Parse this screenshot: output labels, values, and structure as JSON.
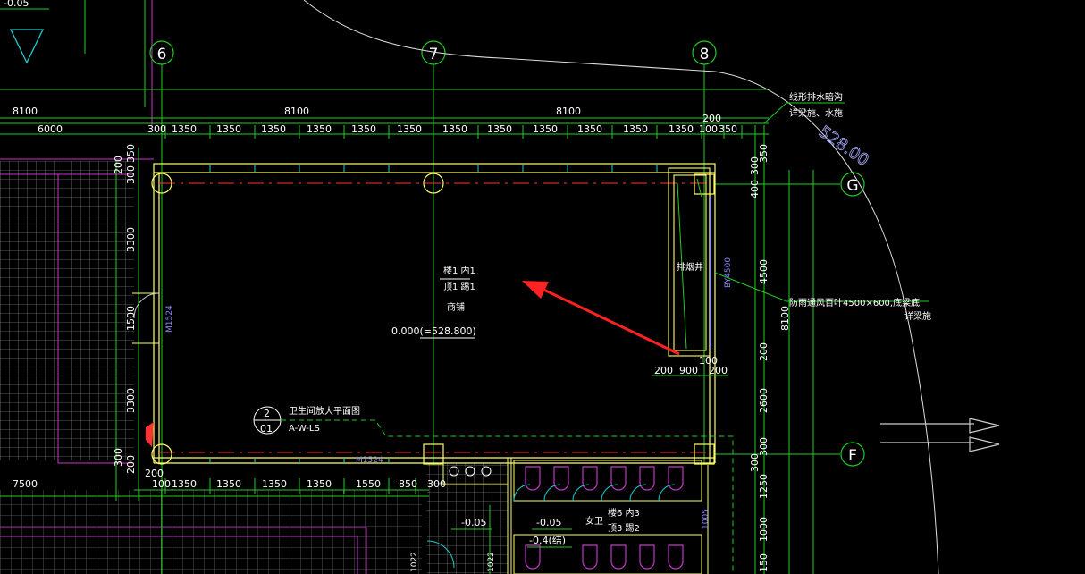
{
  "axes": {
    "col6": "6",
    "col7": "7",
    "col8": "8",
    "rowG": "G",
    "rowF": "F"
  },
  "dims": {
    "top_bay1": "8100",
    "top_bay2": "8100",
    "top_bay3": "8100",
    "top_left": "6000",
    "top_300a": "300",
    "top_1350": "1350",
    "top_300b": "300",
    "top_200": "200",
    "left_350": "350",
    "left_200_top": "200",
    "left_300_top": "300",
    "left_3300_upper": "3300",
    "left_1500": "1500",
    "left_3300_lower": "3300",
    "left_200_bot": "200",
    "left_300_bot": "300",
    "right_400": "400",
    "right_4500": "4500",
    "right_8100": "8100",
    "right_200": "200",
    "right_2600": "2600",
    "right_300": "300",
    "right_1250": "1250",
    "right_1000": "1000",
    "right_150": "150",
    "right_350": "350",
    "right_300_top": "300",
    "shaft_100": "100",
    "shaft_200a": "200",
    "shaft_900": "900",
    "shaft_200b": "200",
    "bot_7500": "7500",
    "bot_200": "200",
    "bot_100": "100",
    "bot_1350": "1350",
    "bot_1550": "1550",
    "bot_850": "850",
    "bot_300": "300"
  },
  "room": {
    "code_a": "楼1 内1",
    "code_b": "顶1 踢1",
    "name": "商铺",
    "elevation": "0.000(=528.800)"
  },
  "door_left": "M1524",
  "door_bottom": "M1524",
  "shaft_label": "排烟井",
  "shaft_dim": "BY4500",
  "callout_note": "防雨通风百叶4500×600,底梁底",
  "callout_note2": "详梁施",
  "drain_note": "线形排水暗沟",
  "drain_note2": "详梁施、水施",
  "contour": "528.00",
  "detail_ref": {
    "num": "2",
    "sheet": "01",
    "title": "卫生间放大平面图",
    "code": "A-W-LS"
  },
  "toilet": {
    "level_a": "-0.05",
    "level_b": "-0.05",
    "level_c": "-0.4(结)",
    "label": "女卫",
    "code_a": "楼6 内3",
    "code_b": "顶3 踢2"
  },
  "misc": {
    "top_level": "-0.05",
    "small_1022a": "1022",
    "small_1022b": "1022",
    "small_1005": "1005"
  },
  "colors": {
    "grid_axis": "#22cc22",
    "wall": "#ffff66",
    "hatch": "#888888",
    "magenta": "#cc33cc",
    "arrow": "#ff2222",
    "red_line": "#ff3333"
  }
}
